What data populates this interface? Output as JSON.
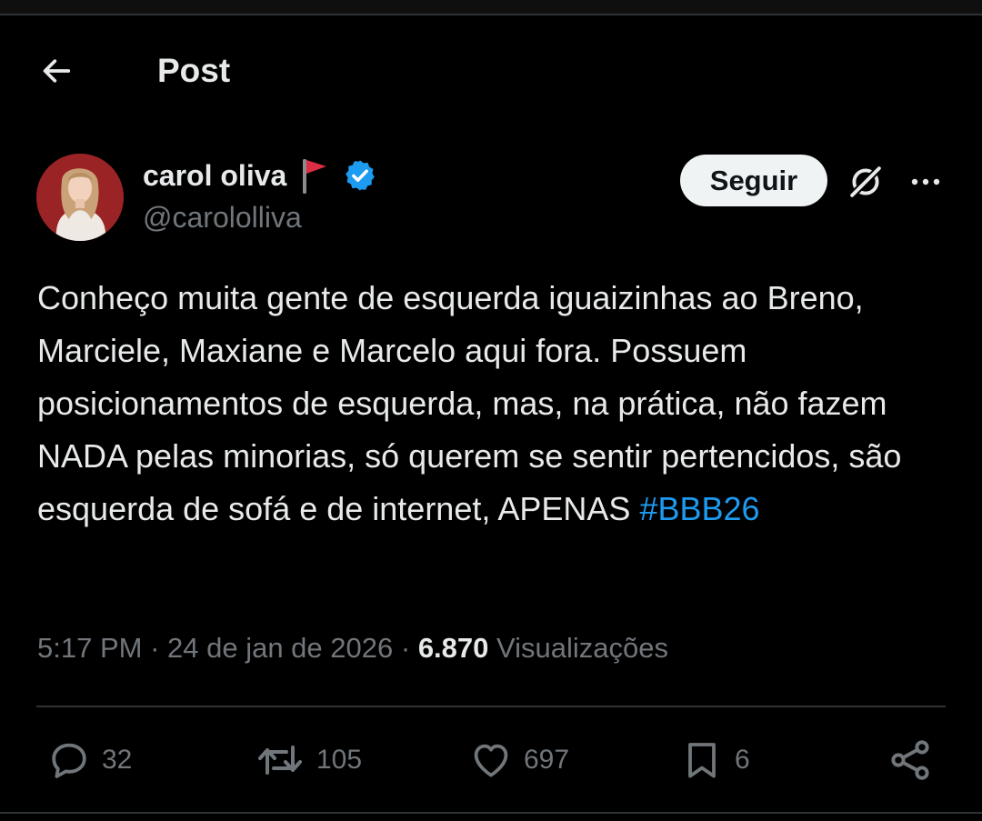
{
  "header": {
    "title": "Post",
    "back_icon": "arrow-left-icon"
  },
  "author": {
    "display_name": "carol oliva",
    "handle": "@carololliva",
    "emoji_icon": "red-flag-icon",
    "verified_icon": "verified-badge-icon",
    "verified_color": "#1d9bf0"
  },
  "actions_top": {
    "follow_label": "Seguir",
    "grok_icon": "grok-icon",
    "more_icon": "more-horizontal-icon"
  },
  "tweet": {
    "text": "Conheço muita gente de esquerda iguaizinhas ao Breno, Marciele, Maxiane e Marcelo aqui fora. Possuem posicionamentos de esquerda, mas, na prática, não fazem NADA pelas minorias, só querem se sentir pertencidos, são esquerda de sofá e de internet, APENAS ",
    "hashtag": "#BBB26"
  },
  "meta": {
    "time": "5:17 PM",
    "separator": " · ",
    "date": "24 de jan de 2026",
    "views_count": "6.870",
    "views_label": "Visualizações"
  },
  "engagement": {
    "replies": "32",
    "reposts": "105",
    "likes": "697",
    "bookmarks": "6"
  },
  "colors": {
    "background": "#000000",
    "text_primary": "#e7e9ea",
    "text_secondary": "#71767b",
    "accent": "#1d9bf0",
    "divider": "#2f3336",
    "follow_bg": "#eff3f4"
  }
}
